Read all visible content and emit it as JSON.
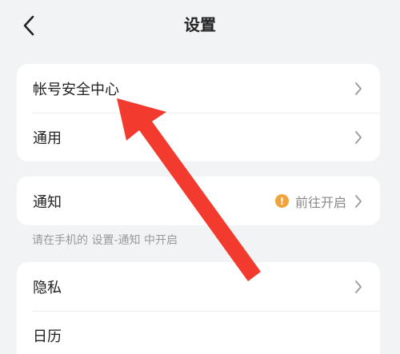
{
  "header": {
    "title": "设置",
    "back_icon": "chevron-left-icon"
  },
  "groups": [
    {
      "items": [
        {
          "label": "帐号安全中心",
          "icon": "chevron-right-icon"
        },
        {
          "label": "通用",
          "icon": "chevron-right-icon"
        }
      ]
    },
    {
      "items": [
        {
          "label": "通知",
          "status_text": "前往开启",
          "status_icon": "warning-dot-icon",
          "status_symbol": "!",
          "status_color": "#f0a33a",
          "icon": "chevron-right-icon"
        }
      ],
      "hint": "请在手机的 设置-通知 中开启"
    },
    {
      "items": [
        {
          "label": "隐私",
          "icon": "chevron-right-icon"
        },
        {
          "label": "日历"
        }
      ]
    }
  ],
  "annotation": {
    "arrow_color": "#f23b2e"
  }
}
